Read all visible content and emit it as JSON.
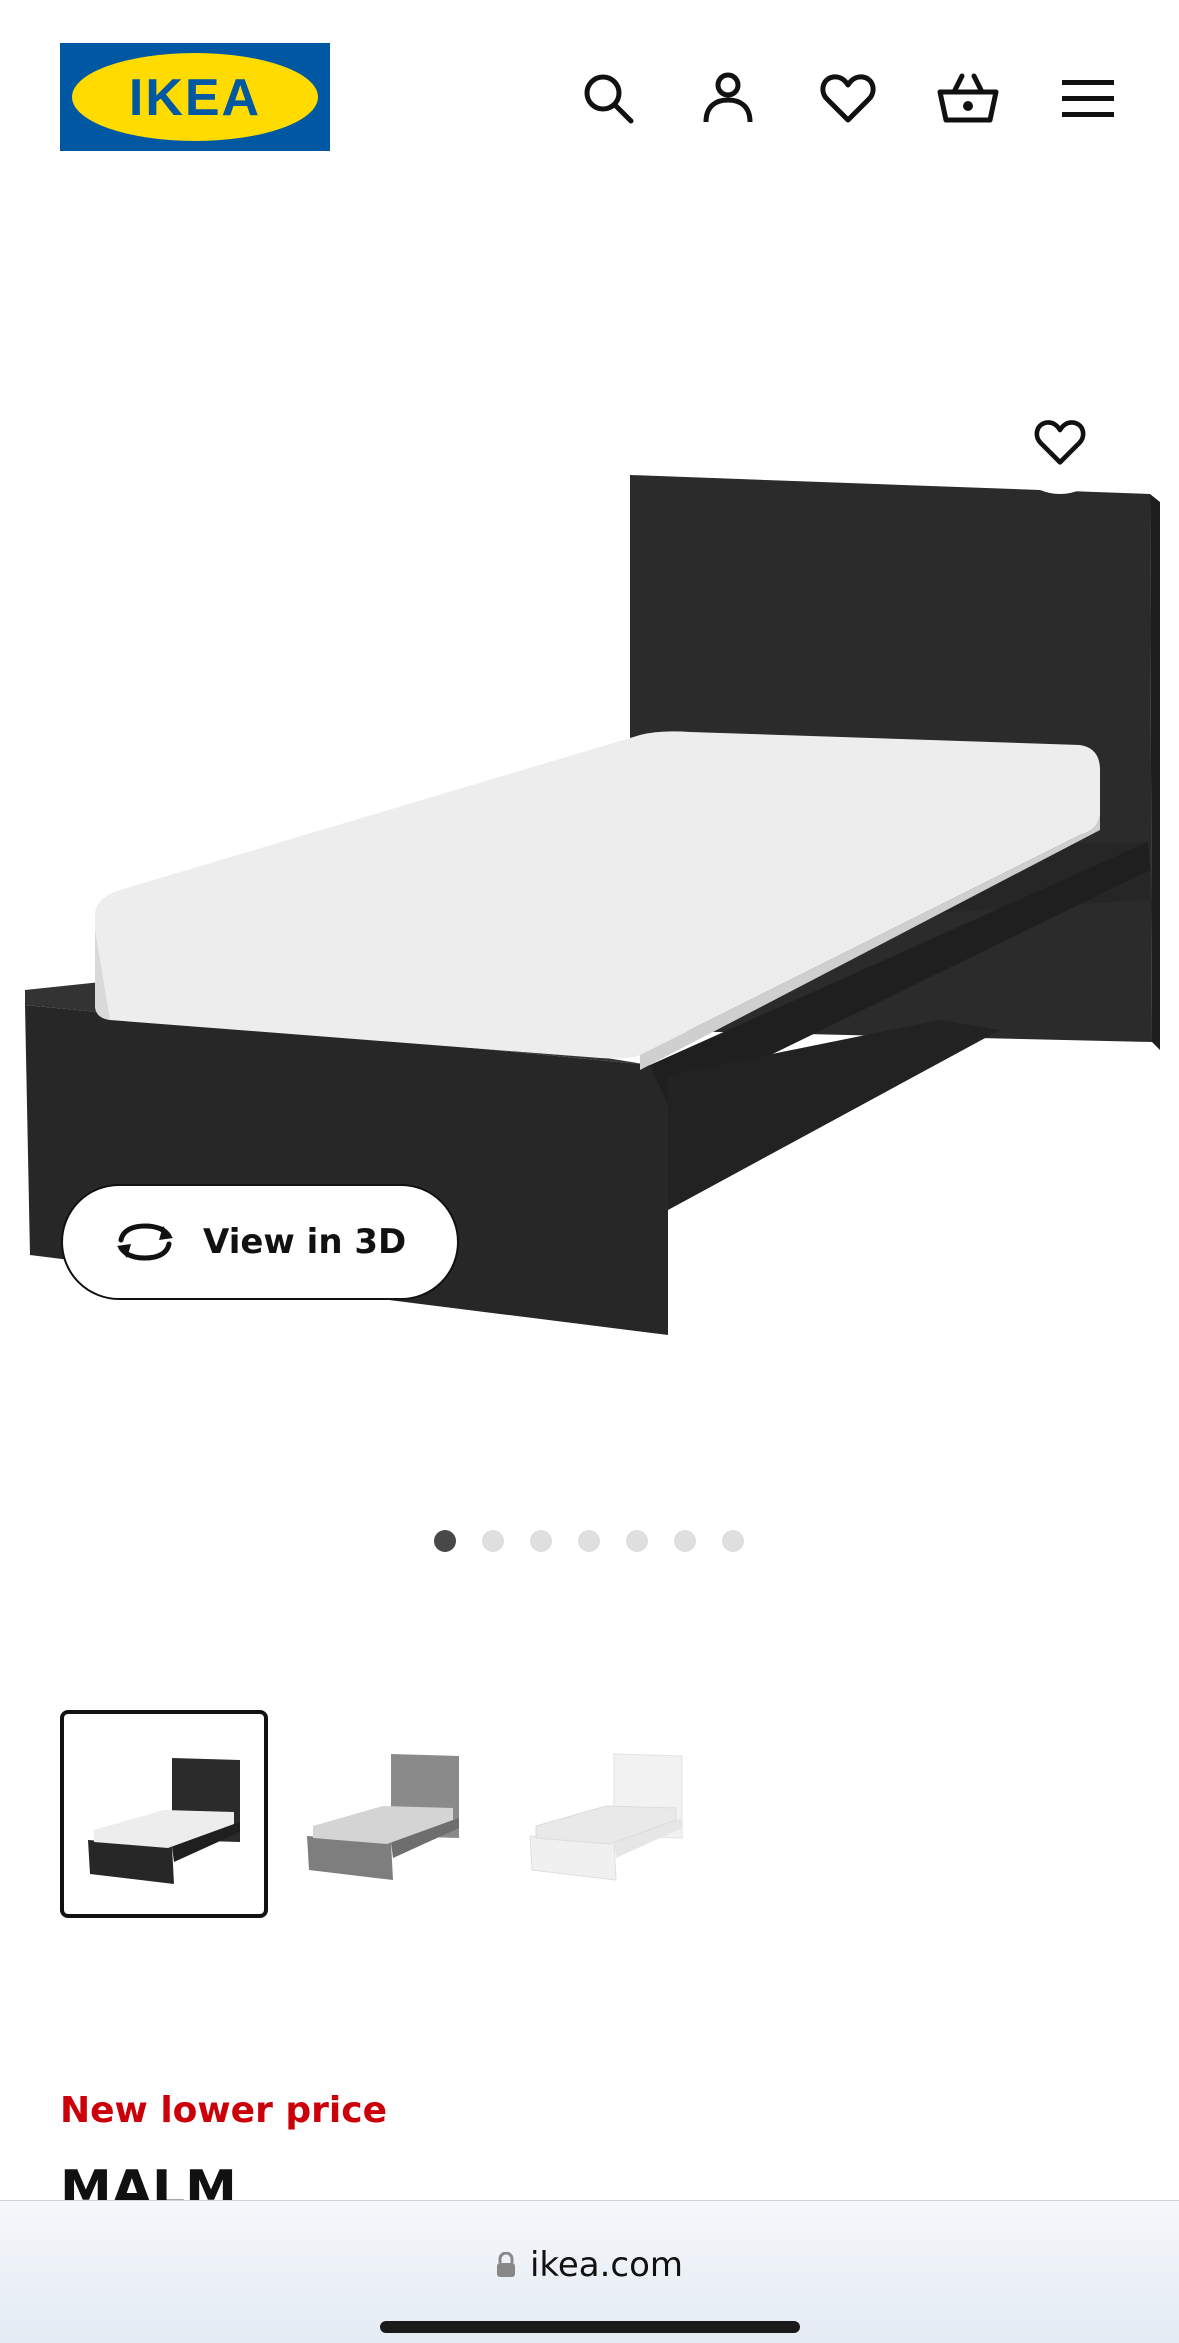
{
  "header": {
    "logo_text": "IKEA",
    "icons": [
      "search-icon",
      "account-icon",
      "heart-icon",
      "cart-icon",
      "menu-icon"
    ]
  },
  "hero": {
    "favourite_icon": "heart-icon",
    "view_3d_label": "View in 3D",
    "view_3d_icon": "rotate-3d-icon",
    "carousel_dot_count": 7,
    "carousel_active_index": 0
  },
  "thumbnails": [
    {
      "variant": "black-brown",
      "selected": true
    },
    {
      "variant": "grey",
      "selected": false
    },
    {
      "variant": "white",
      "selected": false
    }
  ],
  "product": {
    "price_tag": "New lower price",
    "name": "MALM"
  },
  "browser": {
    "url": "ikea.com"
  },
  "colors": {
    "ikea_blue": "#0058A3",
    "ikea_yellow": "#FFDB00",
    "price_red": "#CC0008",
    "bed_dark": "#2a2a2a"
  }
}
